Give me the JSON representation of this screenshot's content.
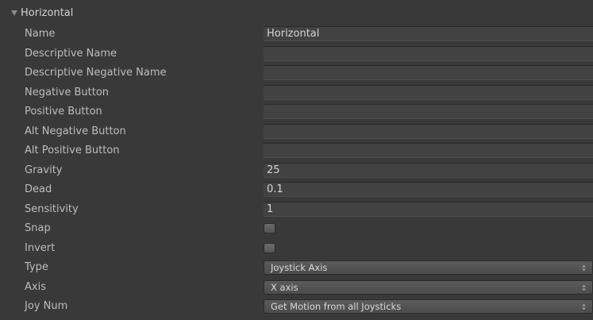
{
  "axis": {
    "title": "Horizontal"
  },
  "icons": {
    "foldout": "triangle-down-icon",
    "dropdown": "up-down-arrows-icon"
  },
  "fields": {
    "name": {
      "label": "Name",
      "value": "Horizontal"
    },
    "descriptive_name": {
      "label": "Descriptive Name",
      "value": ""
    },
    "descriptive_negative_name": {
      "label": "Descriptive Negative Name",
      "value": ""
    },
    "negative_button": {
      "label": "Negative Button",
      "value": ""
    },
    "positive_button": {
      "label": "Positive Button",
      "value": ""
    },
    "alt_negative_button": {
      "label": "Alt Negative Button",
      "value": ""
    },
    "alt_positive_button": {
      "label": "Alt Positive Button",
      "value": ""
    },
    "gravity": {
      "label": "Gravity",
      "value": "25"
    },
    "dead": {
      "label": "Dead",
      "value": "0.1"
    },
    "sensitivity": {
      "label": "Sensitivity",
      "value": "1"
    },
    "snap": {
      "label": "Snap",
      "checked": false
    },
    "invert": {
      "label": "Invert",
      "checked": false
    },
    "type": {
      "label": "Type",
      "selected": "Joystick Axis"
    },
    "axis": {
      "label": "Axis",
      "selected": "X axis"
    },
    "joy_num": {
      "label": "Joy Num",
      "selected": "Get Motion from all Joysticks"
    }
  },
  "colors": {
    "background": "#393939",
    "field": "#424242",
    "text": "#c8c8c8"
  }
}
